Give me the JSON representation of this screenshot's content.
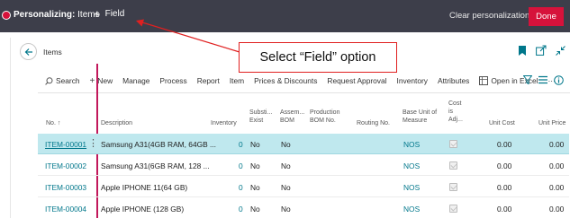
{
  "topbar": {
    "mode_label": "Personalizing:",
    "page_name": "Items",
    "add_field_label": "Field",
    "clear_label": "Clear personalization...",
    "done_label": "Done"
  },
  "page": {
    "title": "Items"
  },
  "actions": {
    "search": "Search",
    "new": "New",
    "manage": "Manage",
    "process": "Process",
    "report": "Report",
    "item": "Item",
    "prices": "Prices & Discounts",
    "approval": "Request Approval",
    "inventory": "Inventory",
    "attributes": "Attributes",
    "excel": "Open in Excel",
    "more": "···"
  },
  "columns": {
    "no": "No. ↑",
    "description": "Description",
    "inventory": "Inventory",
    "subst1": "Substi...",
    "subst2": "Exist",
    "assembly1": "Assem...",
    "assembly2": "BOM",
    "prodbom1": "Production",
    "prodbom2": "BOM No.",
    "routing": "Routing No.",
    "baseunit1": "Base Unit of",
    "baseunit2": "Measure",
    "costadj1": "Cost",
    "costadj2": "is",
    "costadj3": "Adj...",
    "unitcost": "Unit Cost",
    "unitprice": "Unit Price"
  },
  "rows": [
    {
      "no": "ITEM-00001",
      "description": "Samsung A31(4GB RAM, 64GB ...",
      "inventory": "0",
      "subst": "No",
      "assembly": "No",
      "unit": "NOS",
      "unitcost": "0.00",
      "unitprice": "0.00"
    },
    {
      "no": "ITEM-00002",
      "description": "Samsung A31(6GB RAM, 128 ...",
      "inventory": "0",
      "subst": "No",
      "assembly": "No",
      "unit": "NOS",
      "unitcost": "0.00",
      "unitprice": "0.00"
    },
    {
      "no": "ITEM-00003",
      "description": "Apple IPHONE 11(64 GB)",
      "inventory": "0",
      "subst": "No",
      "assembly": "No",
      "unit": "NOS",
      "unitcost": "0.00",
      "unitprice": "0.00"
    },
    {
      "no": "ITEM-00004",
      "description": "Apple IPHONE (128 GB)",
      "inventory": "0",
      "subst": "No",
      "assembly": "No",
      "unit": "NOS",
      "unitcost": "0.00",
      "unitprice": "0.00"
    }
  ],
  "callout": {
    "text": "Select “Field” option"
  },
  "colors": {
    "accent": "#d6123b",
    "link": "#00778b",
    "selected_row": "#bfe8ee",
    "topbar": "#3d3e4a"
  }
}
